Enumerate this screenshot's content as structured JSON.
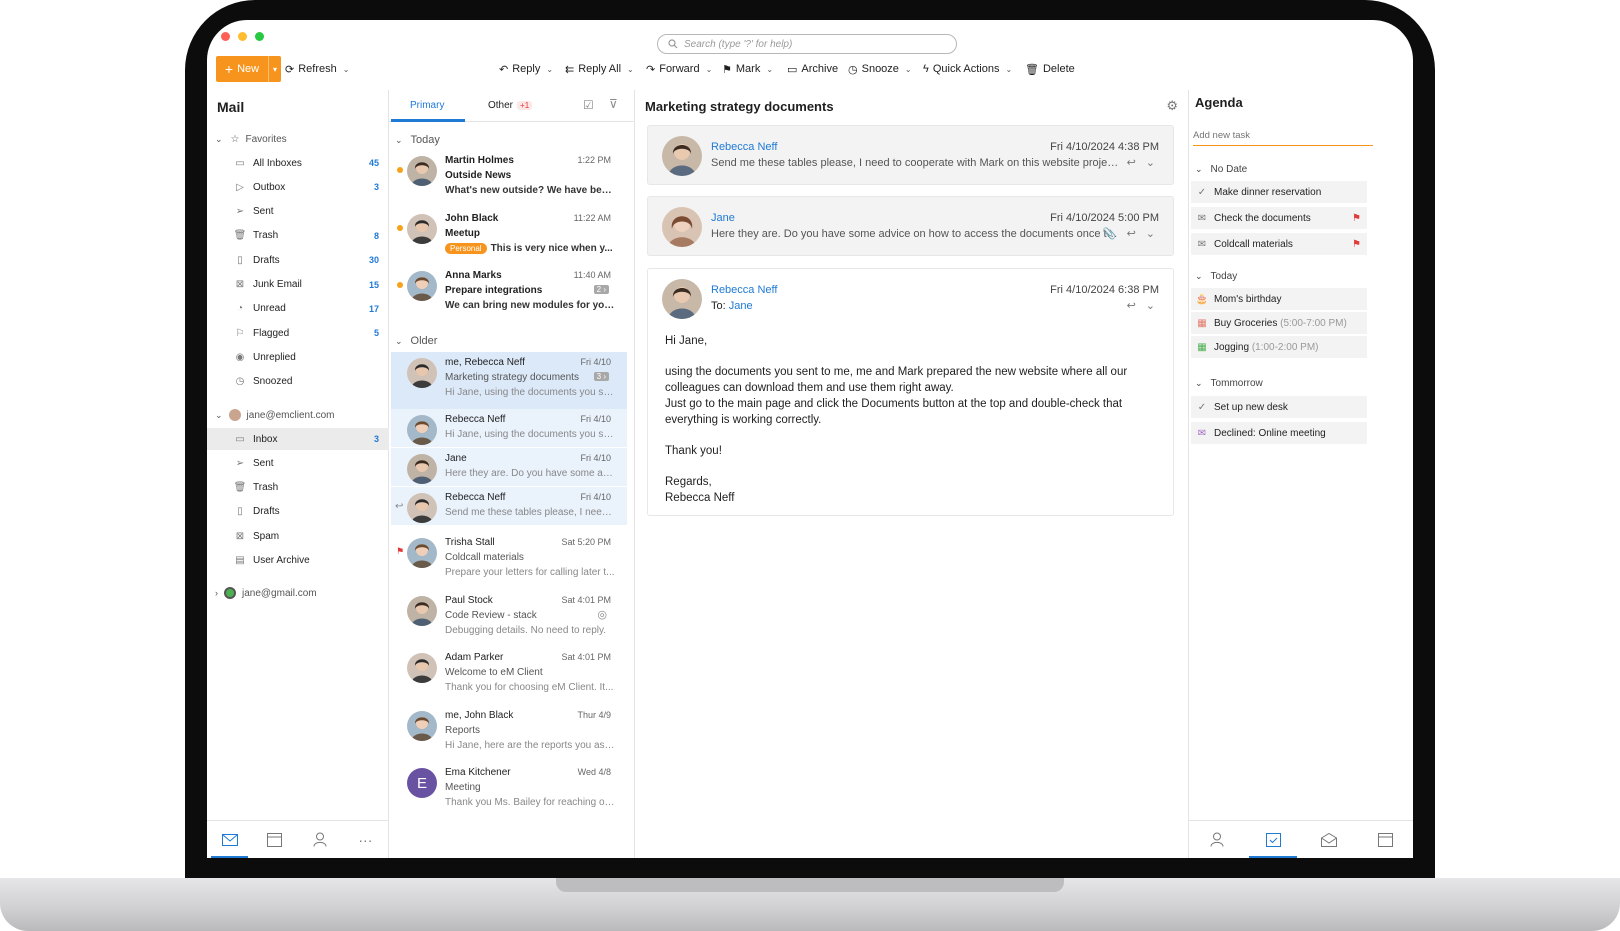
{
  "colors": {
    "accent": "#1f7ad6",
    "new": "#f7941d",
    "flag": "#e23a3a",
    "highlight": "#dce9f9"
  },
  "search": {
    "placeholder": "Search (type '?' for help)"
  },
  "toolbar": {
    "new": "New",
    "refresh": "Refresh",
    "reply": "Reply",
    "reply_all": "Reply All",
    "forward": "Forward",
    "mark": "Mark",
    "archive": "Archive",
    "snooze": "Snooze",
    "quick_actions": "Quick Actions",
    "delete": "Delete"
  },
  "mail": {
    "title": "Mail",
    "favorites_label": "Favorites",
    "favorites": [
      {
        "label": "All Inboxes",
        "count": "45",
        "icon": "inbox-icon"
      },
      {
        "label": "Outbox",
        "count": "3",
        "icon": "outbox-icon"
      },
      {
        "label": "Sent",
        "count": "",
        "icon": "sent-icon"
      },
      {
        "label": "Trash",
        "count": "8",
        "icon": "trash-icon"
      },
      {
        "label": "Drafts",
        "count": "30",
        "icon": "drafts-icon"
      },
      {
        "label": "Junk Email",
        "count": "15",
        "icon": "junk-icon"
      },
      {
        "label": "Unread",
        "count": "17",
        "icon": "unread-icon"
      },
      {
        "label": "Flagged",
        "count": "5",
        "icon": "flag-icon"
      },
      {
        "label": "Unreplied",
        "count": "",
        "icon": "eye-icon"
      },
      {
        "label": "Snoozed",
        "count": "",
        "icon": "snooze-icon"
      }
    ],
    "account1": "jane@emclient.com",
    "account1_folders": [
      {
        "label": "Inbox",
        "count": "3",
        "icon": "inbox-icon"
      },
      {
        "label": "Sent",
        "count": "",
        "icon": "sent-icon"
      },
      {
        "label": "Trash",
        "count": "",
        "icon": "trash-icon"
      },
      {
        "label": "Drafts",
        "count": "",
        "icon": "drafts-icon"
      },
      {
        "label": "Spam",
        "count": "",
        "icon": "junk-icon"
      },
      {
        "label": "User Archive",
        "count": "",
        "icon": "archive-icon"
      }
    ],
    "account2": "jane@gmail.com"
  },
  "list": {
    "tab_primary": "Primary",
    "tab_other": "Other",
    "other_badge": "+1",
    "section_today": "Today",
    "section_older": "Older",
    "today": [
      {
        "from": "Martin Holmes",
        "time": "1:22 PM",
        "subject": "Outside News",
        "preview": "What's new outside? We have been...",
        "pill": "",
        "count": ""
      },
      {
        "from": "John Black",
        "time": "11:22 AM",
        "subject": "Meetup",
        "preview": "This is very nice when y...",
        "pill": "Personal",
        "count": ""
      },
      {
        "from": "Anna Marks",
        "time": "11:40 AM",
        "subject": "Prepare integrations",
        "preview": "We can bring new modules for you...",
        "pill": "",
        "count": "2 ›"
      }
    ],
    "older": [
      {
        "from": "me, Rebecca Neff",
        "time": "Fri 4/10",
        "subject": "Marketing strategy documents",
        "preview": "Hi Jane, using the documents you se...",
        "count": "3 ›"
      },
      {
        "from": "Rebecca Neff",
        "time": "Fri 4/10",
        "subject": "",
        "preview": "Hi Jane, using the documents you se..."
      },
      {
        "from": "Jane",
        "time": "Fri 4/10",
        "subject": "",
        "preview": "Here they are. Do you have some adv..."
      },
      {
        "from": "Rebecca Neff",
        "time": "Fri 4/10",
        "subject": "",
        "preview": "Send me these tables please, I need t..."
      },
      {
        "from": "Trisha Stall",
        "time": "Sat 5:20 PM",
        "subject": "Coldcall materials",
        "preview": "Prepare your letters for calling later t..."
      },
      {
        "from": "Paul Stock",
        "time": "Sat 4:01 PM",
        "subject": "Code Review - stack",
        "preview": "Debugging details. No need to reply."
      },
      {
        "from": "Adam Parker",
        "time": "Sat 4:01 PM",
        "subject": "Welcome to eM Client",
        "preview": "Thank you for choosing eM Client. It..."
      },
      {
        "from": "me, John Black",
        "time": "Thur 4/9",
        "subject": "Reports",
        "preview": "Hi Jane, here are the reports you ask..."
      },
      {
        "from": "Ema Kitchener",
        "time": "Wed 4/8",
        "subject": "Meeting",
        "preview": "Thank you Ms. Bailey for reaching ou...",
        "initial": "E"
      }
    ]
  },
  "reader": {
    "title": "Marketing strategy documents",
    "messages": [
      {
        "name": "Rebecca Neff",
        "date": "Fri 4/10/2024 4:38 PM",
        "preview": "Send me these tables please, I need to cooperate with Mark on this website project..."
      },
      {
        "name": "Jane",
        "date": "Fri 4/10/2024 5:00 PM",
        "preview": "Here they are. Do you have some advice on how to access the documents once th..."
      },
      {
        "name": "Rebecca Neff",
        "date": "Fri 4/10/2024 6:38 PM",
        "to_label": "To:",
        "to": "Jane"
      }
    ],
    "body": {
      "greeting": "Hi Jane,",
      "p1": "using the documents you sent to me, me and Mark prepared the new website where all our colleagues can download them and use them right away.",
      "p2": "Just go to the main page and click the Documents button at the top and double-check that everything is working correctly.",
      "thanks": "Thank you!",
      "regards": "Regards,",
      "signature": "Rebecca Neff"
    }
  },
  "agenda": {
    "title": "Agenda",
    "add_placeholder": "Add new task",
    "no_date": "No Date",
    "today": "Today",
    "tomorrow": "Tommorrow",
    "no_date_items": [
      {
        "label": "Make dinner reservation",
        "time": "",
        "flag": false
      },
      {
        "label": "Check the documents",
        "time": "",
        "flag": true
      },
      {
        "label": "Coldcall materials",
        "time": "",
        "flag": true
      }
    ],
    "today_items": [
      {
        "label": "Mom's birthday",
        "time": ""
      },
      {
        "label": "Buy Groceries",
        "time": "(5:00-7:00 PM)"
      },
      {
        "label": "Jogging",
        "time": "(1:00-2:00 PM)"
      }
    ],
    "tomorrow_items": [
      {
        "label": "Set up new desk",
        "time": ""
      },
      {
        "label": "Declined: Online meeting",
        "time": ""
      }
    ]
  }
}
